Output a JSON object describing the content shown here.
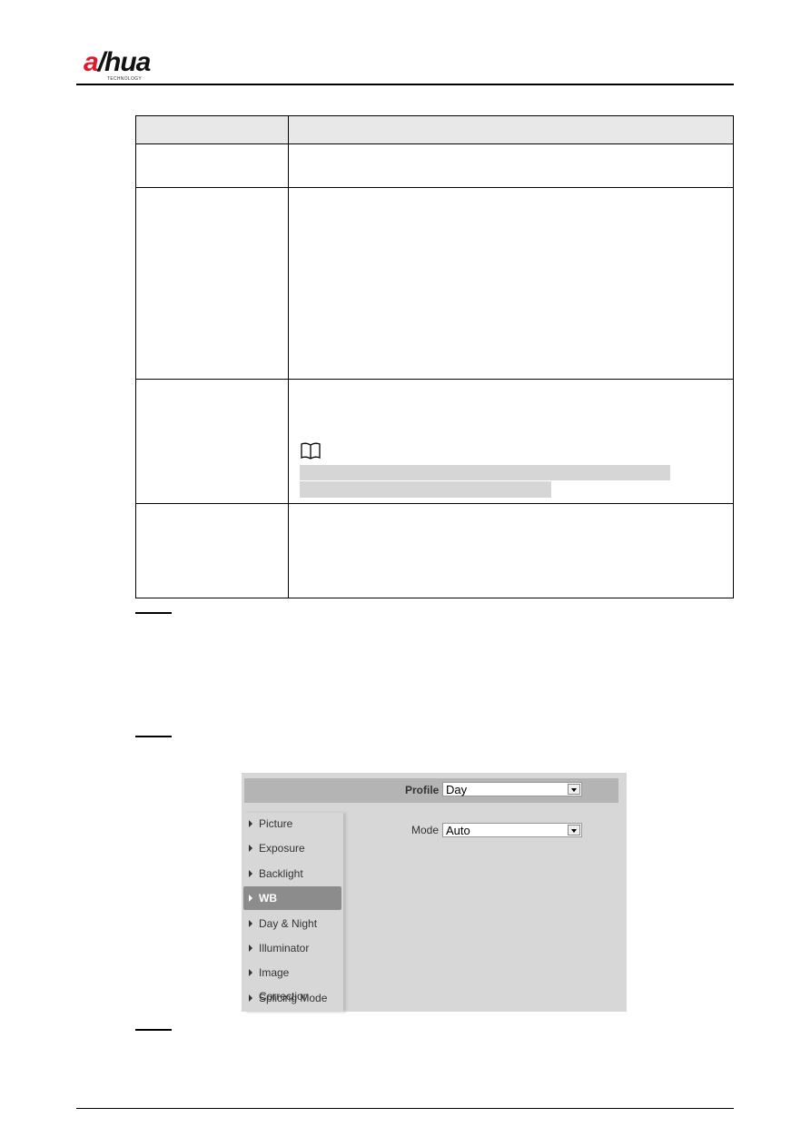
{
  "logo": {
    "text": "alhua",
    "tagline": "TECHNOLOGY",
    "brand_color": "#e0182d"
  },
  "screenshot": {
    "profile_label": "Profile",
    "profile_value": "Day",
    "mode_label": "Mode",
    "mode_value": "Auto",
    "menu": [
      {
        "label": "Picture",
        "active": false
      },
      {
        "label": "Exposure",
        "active": false
      },
      {
        "label": "Backlight",
        "active": false
      },
      {
        "label": "WB",
        "active": true
      },
      {
        "label": "Day & Night",
        "active": false
      },
      {
        "label": "Illuminator",
        "active": false
      },
      {
        "label": "Image Correction",
        "active": false
      },
      {
        "label": "Splicing Mode",
        "active": false
      }
    ]
  },
  "icons": {
    "note": "book-note-icon",
    "menu_arrow": "triangle-right-icon",
    "dropdown": "chevron-down-icon"
  }
}
